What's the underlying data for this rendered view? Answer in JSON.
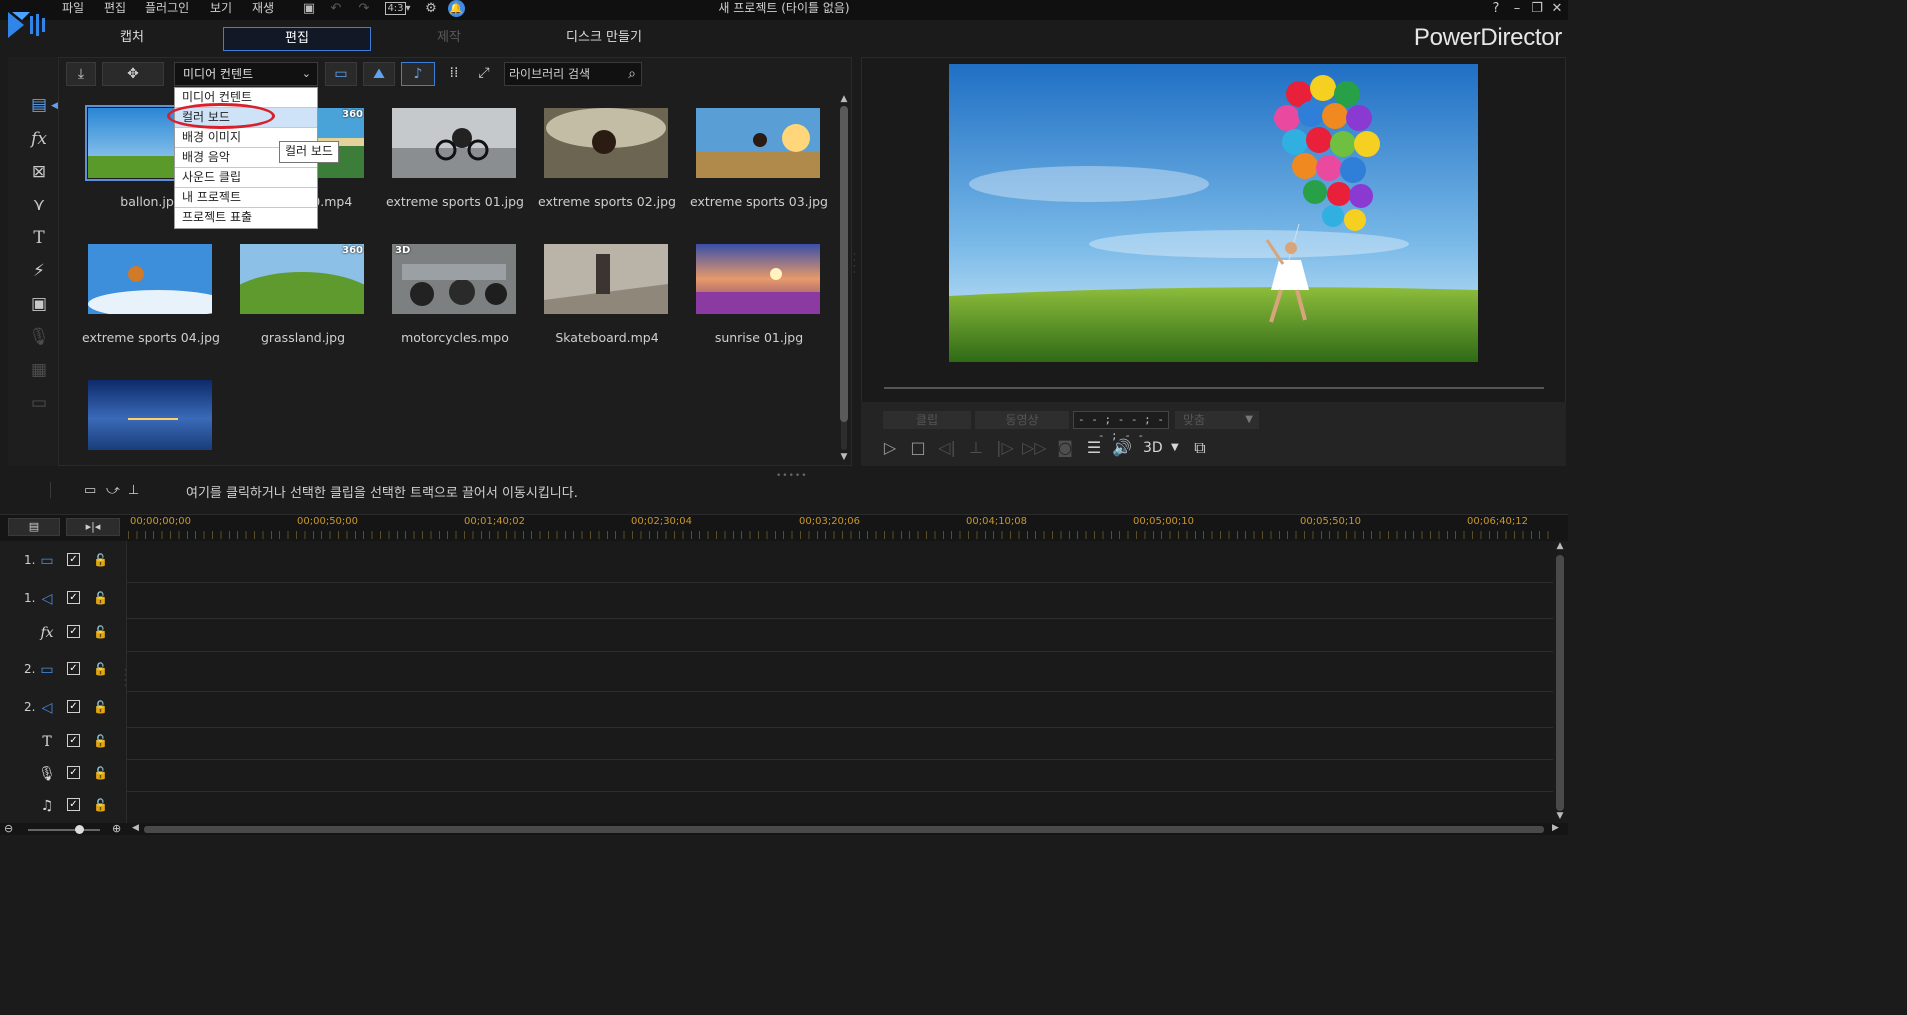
{
  "menu": {
    "items": [
      "파일",
      "편집",
      "플러그인",
      "보기",
      "재생"
    ],
    "aspect_ratio": "4:3"
  },
  "window_title": "새 프로젝트 (타이틀 없음)",
  "window_controls": {
    "help": "?",
    "minimize": "–",
    "restore": "❐",
    "close": "✕"
  },
  "mode_tabs": [
    {
      "label": "캡처",
      "state": "normal"
    },
    {
      "label": "편집",
      "state": "active"
    },
    {
      "label": "제작",
      "state": "disabled"
    },
    {
      "label": "디스크 만들기",
      "state": "normal"
    }
  ],
  "brand": "PowerDirector",
  "library": {
    "filter_value": "미디어 컨텐트",
    "search_placeholder": "라이브러리 검색",
    "dropdown": {
      "items": [
        "미디어 컨텐트",
        "컬러 보드",
        "배경 이미지",
        "배경 음악",
        "사운드 클립",
        "내 프로젝트",
        "프로젝트 표출"
      ],
      "hovered": "컬러 보드",
      "tooltip": "컬러 보드"
    },
    "media": [
      {
        "label": "ballon.jpg",
        "badge": "",
        "selected": true
      },
      {
        "label": "Beach 360.mp4",
        "badge": "360",
        "selected": false
      },
      {
        "label": "extreme sports 01.jpg",
        "badge": "",
        "selected": false
      },
      {
        "label": "extreme sports 02.jpg",
        "badge": "",
        "selected": false
      },
      {
        "label": "extreme sports 03.jpg",
        "badge": "",
        "selected": false
      },
      {
        "label": "extreme sports 04.jpg",
        "badge": "",
        "selected": false
      },
      {
        "label": "grassland.jpg",
        "badge": "360",
        "selected": false
      },
      {
        "label": "motorcycles.mpo",
        "badge": "3D",
        "selected": false
      },
      {
        "label": "Skateboard.mp4",
        "badge": "",
        "selected": false
      },
      {
        "label": "sunrise 01.jpg",
        "badge": "",
        "selected": false
      },
      {
        "label": "",
        "badge": "",
        "selected": false
      }
    ]
  },
  "preview": {
    "clip_button": "클립",
    "movie_button": "동영상",
    "timecode": "- - ; - - ; - - ; - -",
    "fit": "맞춤",
    "mode_3d": "3D"
  },
  "timeline": {
    "hint": "여기를 클릭하거나 선택한 클립을 선택한 트랙으로 끌어서 이동시킵니다.",
    "ruler_labels": [
      "00;00;00;00",
      "00;00;50;00",
      "00;01;40;02",
      "00;02;30;04",
      "00;03;20;06",
      "00;04;10;08",
      "00;05;00;10",
      "00;05;50;10",
      "00;06;40;12"
    ],
    "tracks": [
      {
        "number": "1.",
        "icon": "video-track-icon",
        "glyph": "▭",
        "checked": true
      },
      {
        "number": "1.",
        "icon": "audio-track-icon",
        "glyph": "◁",
        "checked": true
      },
      {
        "number": "",
        "icon": "fx-track-icon",
        "glyph": "fx",
        "checked": true
      },
      {
        "number": "2.",
        "icon": "video-track-icon",
        "glyph": "▭",
        "checked": true
      },
      {
        "number": "2.",
        "icon": "audio-track-icon",
        "glyph": "◁",
        "checked": true
      },
      {
        "number": "",
        "icon": "title-track-icon",
        "glyph": "T",
        "checked": true
      },
      {
        "number": "",
        "icon": "voice-track-icon",
        "glyph": "🎙",
        "checked": true
      },
      {
        "number": "",
        "icon": "music-track-icon",
        "glyph": "♫",
        "checked": true
      }
    ]
  },
  "colors": {
    "accent": "#3e7ed8",
    "highlight_ellipse": "#d9202a",
    "ruler_text": "#c7962a"
  }
}
